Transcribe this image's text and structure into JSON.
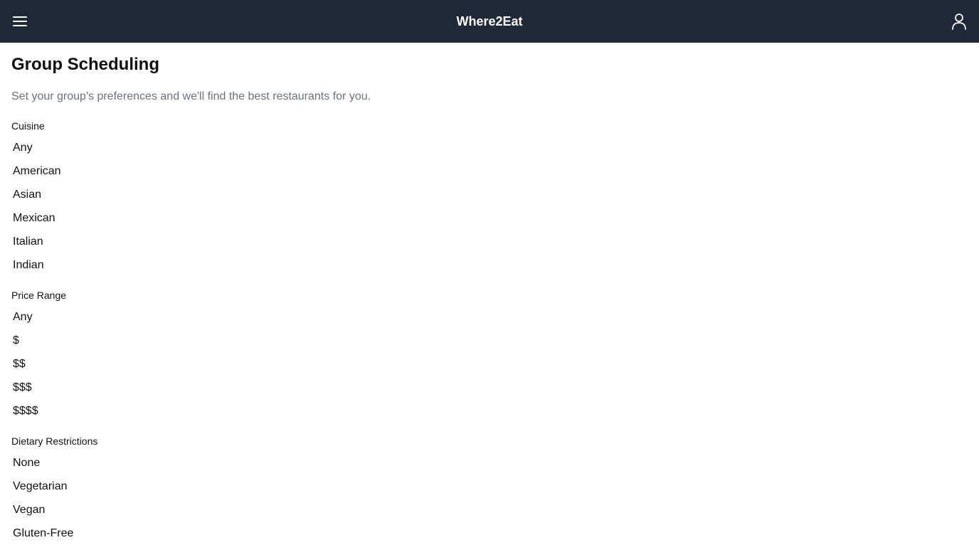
{
  "header": {
    "title": "Where2Eat",
    "menu_icon": "hamburger-menu-icon",
    "user_icon": "user-icon",
    "background": "#1f2937"
  },
  "main": {
    "title": "Group Scheduling",
    "subtitle": "Set your group's preferences and we'll find the best restaurants for you.",
    "sections": [
      {
        "label": "Cuisine",
        "options": [
          "Any",
          "American",
          "Asian",
          "Mexican",
          "Italian",
          "Indian"
        ]
      },
      {
        "label": "Price Range",
        "options": [
          "Any",
          "$",
          "$$",
          "$$$",
          "$$$$"
        ]
      },
      {
        "label": "Dietary Restrictions",
        "options": [
          "None",
          "Vegetarian",
          "Vegan",
          "Gluten-Free"
        ]
      }
    ]
  }
}
